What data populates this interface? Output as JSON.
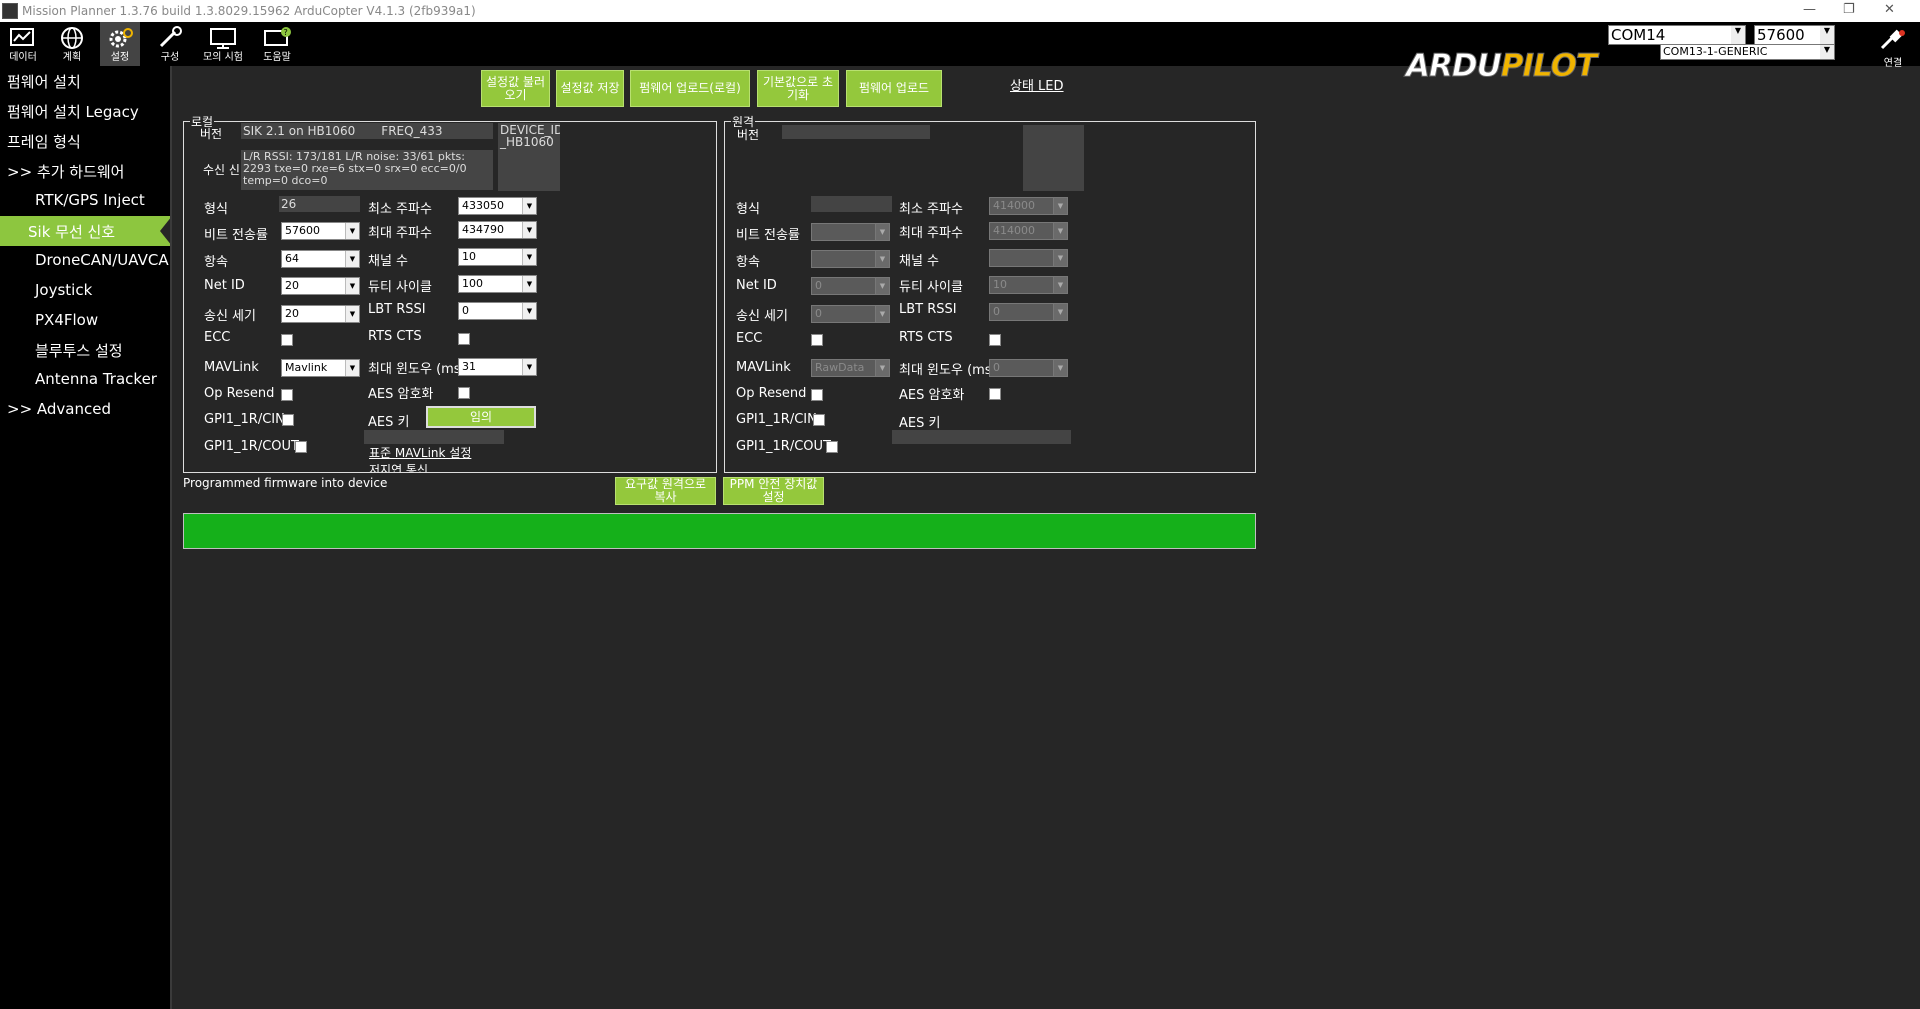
{
  "window": {
    "title": "Mission Planner 1.3.76 build 1.3.8029.15962 ArduCopter V4.1.3 (2fb939a1)"
  },
  "toolbar": {
    "items": [
      {
        "label": "데이터"
      },
      {
        "label": "계획"
      },
      {
        "label": "설정"
      },
      {
        "label": "구성"
      },
      {
        "label": "모의 시험"
      },
      {
        "label": "도움말"
      }
    ],
    "logo_ardu": "ARDU",
    "logo_pilot": "PILOT",
    "port": "COM14",
    "port_detail": "COM13-1-GENERIC",
    "baud": "57600",
    "connect_label": "연결"
  },
  "sidebar": {
    "items": [
      {
        "label": "펌웨어 설치"
      },
      {
        "label": "펌웨어 설치 Legacy"
      },
      {
        "label": "프레임 형식"
      },
      {
        "label": ">> 추가 하드웨어"
      },
      {
        "label": "RTK/GPS Inject"
      },
      {
        "label": "Sik 무선 신호"
      },
      {
        "label": "DroneCAN/UAVCAN"
      },
      {
        "label": "Joystick"
      },
      {
        "label": "PX4Flow"
      },
      {
        "label": "블루투스 설정"
      },
      {
        "label": "Antenna Tracker"
      },
      {
        "label": ">> Advanced"
      }
    ]
  },
  "actions": {
    "load_settings": "설정값 불러오기",
    "save_settings": "설정값 저장",
    "upload_firmware_local": "펌웨어 업로드(로컬)",
    "reset_defaults": "기본값으로 초기화",
    "upload_firmware": "펌웨어 업로드",
    "status_led": "상태 LED"
  },
  "local": {
    "title": "로컬",
    "version_label": "버전",
    "version": "SIK 2.1 on HB1060",
    "freq": "FREQ_433",
    "device_id": "DEVICE_ID _HB1060",
    "rx_label": "수신 신",
    "rx_info": "L/R RSSI: 173/181  L/R noise: 33/61 pkts: 2293  txe=0 rxe=6 stx=0 srx=0 ecc=0/0 temp=0 dco=0",
    "format_label": "형식",
    "format": "26",
    "baud_label": "비트 전송률",
    "baud": "57600",
    "airspeed_label": "항속",
    "airspeed": "64",
    "netid_label": "Net ID",
    "netid": "20",
    "txpower_label": "송신 세기",
    "txpower": "20",
    "ecc_label": "ECC",
    "mavlink_label": "MAVLink",
    "mavlink": "Mavlink",
    "opresend_label": "Op Resend",
    "gpi_cin_label": "GPI1_1R/CIN",
    "gpi_cout_label": "GPI1_1R/COUT",
    "minfreq_label": "최소 주파수",
    "minfreq": "433050",
    "maxfreq_label": "최대 주파수",
    "maxfreq": "434790",
    "channels_label": "채널 수",
    "channels": "10",
    "duty_label": "듀티 사이클",
    "duty": "100",
    "lbt_label": "LBT RSSI",
    "lbt": "0",
    "rtscts_label": "RTS CTS",
    "maxwindow_label": "최대 윈도우 (ms)",
    "maxwindow": "31",
    "aes_enc_label": "AES 암호화",
    "aes_key_label": "AES 키",
    "aes_key_button": "임의",
    "std_mavlink_link": "표준 MAVLink 설정",
    "low_latency_link": "저지연 통신"
  },
  "remote": {
    "title": "원격",
    "version_label": "버전",
    "format_label": "형식",
    "baud_label": "비트 전송률",
    "airspeed_label": "항속",
    "netid_label": "Net ID",
    "netid": "0",
    "txpower_label": "송신 세기",
    "txpower": "0",
    "ecc_label": "ECC",
    "mavlink_label": "MAVLink",
    "mavlink": "RawData",
    "opresend_label": "Op Resend",
    "gpi_cin_label": "GPI1_1R/CIN",
    "gpi_cout_label": "GPI1_1R/COUT",
    "minfreq_label": "최소 주파수",
    "minfreq": "414000",
    "maxfreq_label": "최대 주파수",
    "maxfreq": "414000",
    "channels_label": "채널 수",
    "duty_label": "듀티 사이클",
    "duty": "10",
    "lbt_label": "LBT RSSI",
    "lbt": "0",
    "rtscts_label": "RTS CTS",
    "maxwindow_label": "최대 윈도우 (ms)",
    "maxwindow": "0",
    "aes_enc_label": "AES 암호화",
    "aes_key_label": "AES 키"
  },
  "bottom": {
    "status": "Programmed firmware into device",
    "copy_required": "요구값 원격으로 복사",
    "ppm_failsafe": "PPM 안전 장치값 설정",
    "progress": 100
  },
  "colors": {
    "accent": "#94c83c",
    "progress": "#15b01a"
  }
}
